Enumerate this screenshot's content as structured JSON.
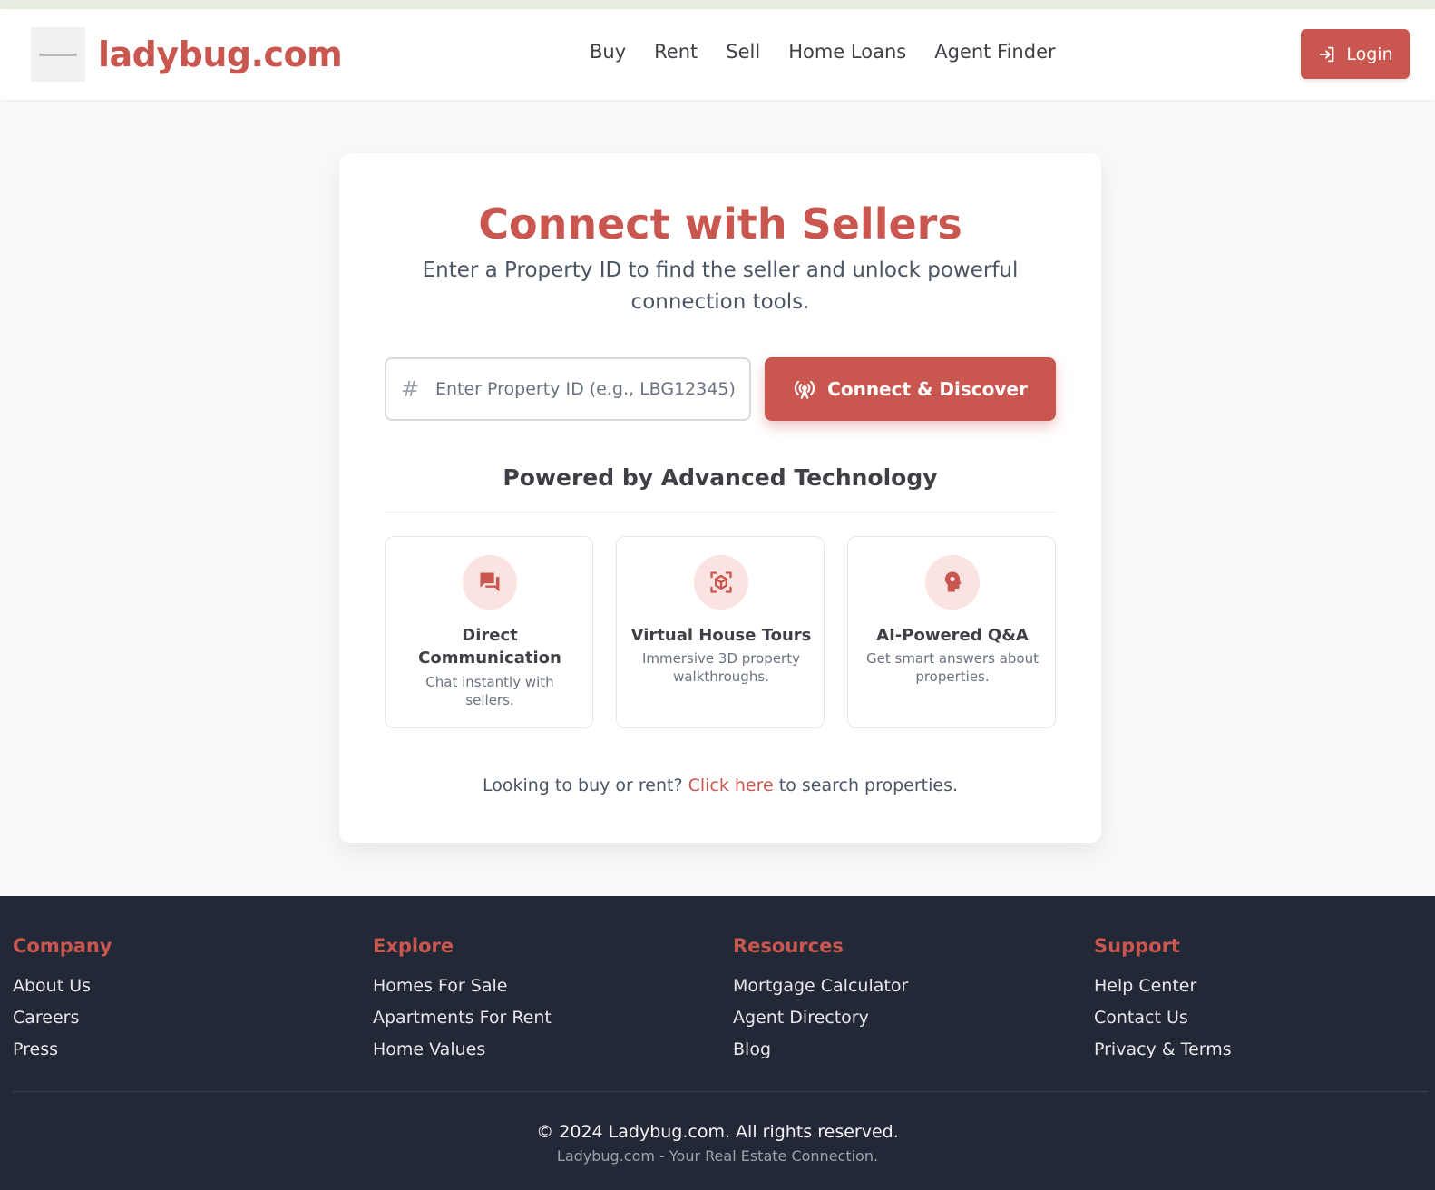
{
  "header": {
    "brand": "ladybug.com",
    "nav": [
      "Buy",
      "Rent",
      "Sell",
      "Home Loans",
      "Agent Finder"
    ],
    "login_label": "Login"
  },
  "main": {
    "title": "Connect with Sellers",
    "subtitle": "Enter a Property ID to find the seller and unlock powerful connection tools.",
    "input_placeholder": "Enter Property ID (e.g., LBG12345)",
    "connect_label": "Connect & Discover",
    "powered_title": "Powered by Advanced Technology",
    "features": [
      {
        "title": "Direct Communication",
        "desc": "Chat instantly with sellers.",
        "icon": "chat-icon"
      },
      {
        "title": "Virtual House Tours",
        "desc": "Immersive 3D property walkthroughs.",
        "icon": "3d-cube-icon"
      },
      {
        "title": "AI-Powered Q&A",
        "desc": "Get smart answers about properties.",
        "icon": "ai-head-icon"
      }
    ],
    "bottom_prefix": "Looking to buy or rent?",
    "bottom_link": "Click here",
    "bottom_suffix": "to search properties."
  },
  "footer": {
    "columns": [
      {
        "title": "Company",
        "links": [
          "About Us",
          "Careers",
          "Press"
        ]
      },
      {
        "title": "Explore",
        "links": [
          "Homes For Sale",
          "Apartments For Rent",
          "Home Values"
        ]
      },
      {
        "title": "Resources",
        "links": [
          "Mortgage Calculator",
          "Agent Directory",
          "Blog"
        ]
      },
      {
        "title": "Support",
        "links": [
          "Help Center",
          "Contact Us",
          "Privacy & Terms"
        ]
      }
    ],
    "copyright": "© 2024 Ladybug.com. All rights reserved.",
    "tagline": "Ladybug.com - Your Real Estate Connection."
  },
  "colors": {
    "accent": "#c9574f",
    "footer_bg": "#222835",
    "icon_bg": "#fbe3e1"
  }
}
